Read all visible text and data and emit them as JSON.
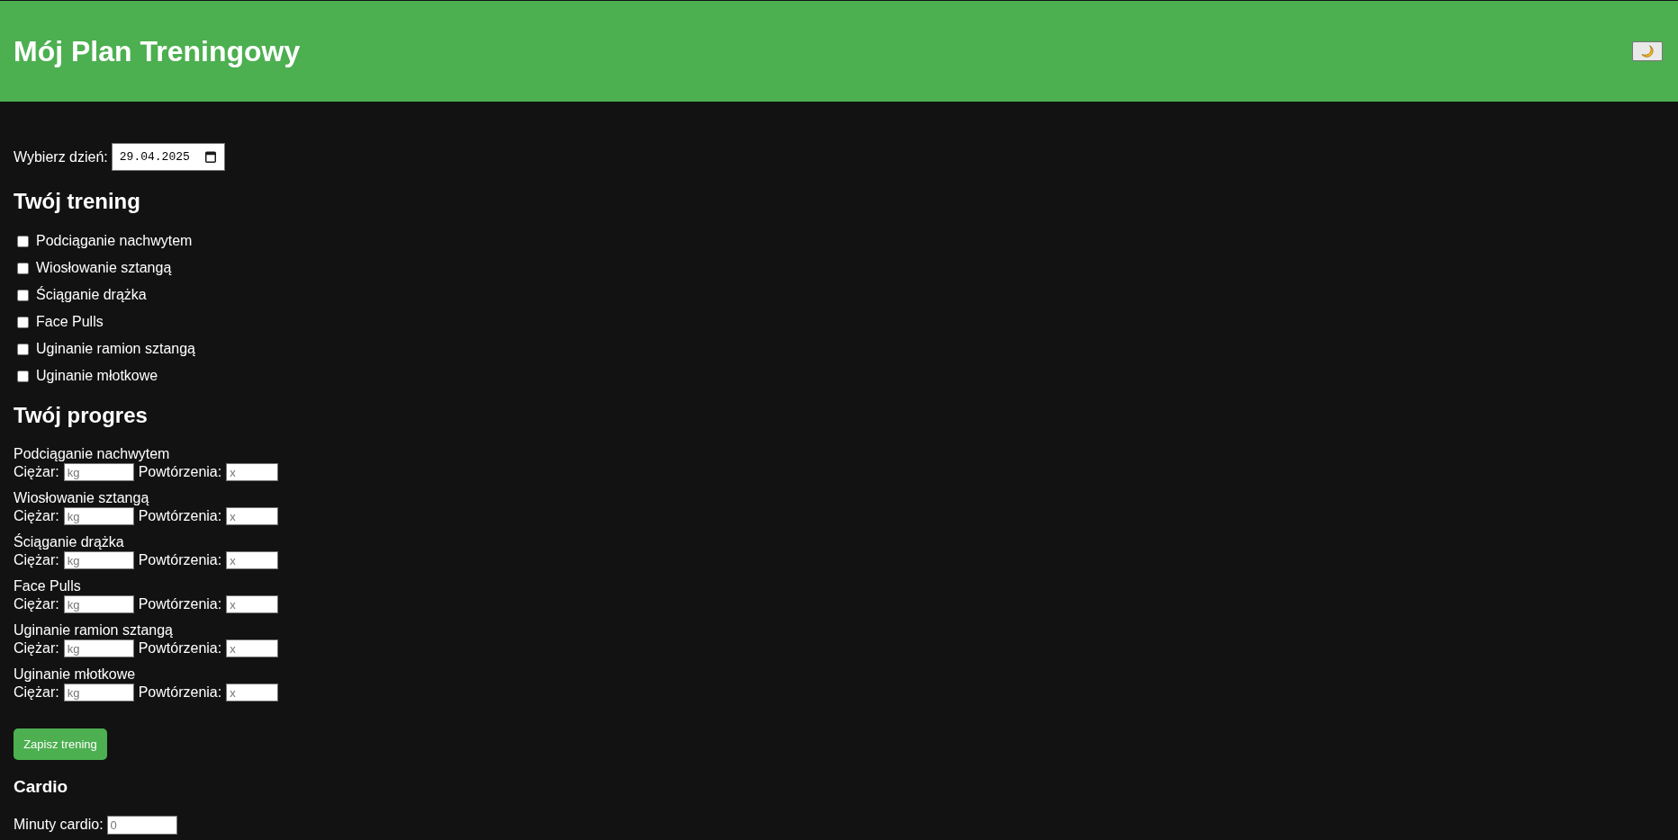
{
  "header": {
    "title": "Mój Plan Treningowy"
  },
  "date_picker": {
    "label": "Wybierz dzień:",
    "value": "29.04.2025"
  },
  "workout": {
    "title": "Twój trening",
    "exercises": [
      {
        "label": "Podciąganie nachwytem",
        "checked": false
      },
      {
        "label": "Wiosłowanie sztangą",
        "checked": false
      },
      {
        "label": "Ściąganie drążka",
        "checked": false
      },
      {
        "label": "Face Pulls",
        "checked": false
      },
      {
        "label": "Uginanie ramion sztangą",
        "checked": false
      },
      {
        "label": "Uginanie młotkowe",
        "checked": false
      }
    ]
  },
  "progress": {
    "title": "Twój progres",
    "entries": [
      {
        "name": "Podciąganie nachwytem",
        "weight": {
          "label": "Ciężar:",
          "placeholder": "kg"
        },
        "reps": {
          "label": "Powtórzenia:",
          "placeholder": "x"
        }
      },
      {
        "name": "Wiosłowanie sztangą",
        "weight": {
          "label": "Ciężar:",
          "placeholder": "kg"
        },
        "reps": {
          "label": "Powtórzenia:",
          "placeholder": "x"
        }
      },
      {
        "name": "Ściąganie drążka",
        "weight": {
          "label": "Ciężar:",
          "placeholder": "kg"
        },
        "reps": {
          "label": "Powtórzenia:",
          "placeholder": "x"
        }
      },
      {
        "name": "Face Pulls",
        "weight": {
          "label": "Ciężar:",
          "placeholder": "kg"
        },
        "reps": {
          "label": "Powtórzenia:",
          "placeholder": "x"
        }
      },
      {
        "name": "Uginanie ramion sztangą",
        "weight": {
          "label": "Ciężar:",
          "placeholder": "kg"
        },
        "reps": {
          "label": "Powtórzenia:",
          "placeholder": "x"
        }
      },
      {
        "name": "Uginanie młotkowe",
        "weight": {
          "label": "Ciężar:",
          "placeholder": "kg"
        },
        "reps": {
          "label": "Powtórzenia:",
          "placeholder": "x"
        }
      }
    ]
  },
  "save_button": {
    "label": "Zapisz trening"
  },
  "cardio": {
    "title": "Cardio",
    "minutes": {
      "label": "Minuty cardio:",
      "placeholder": "0"
    }
  }
}
